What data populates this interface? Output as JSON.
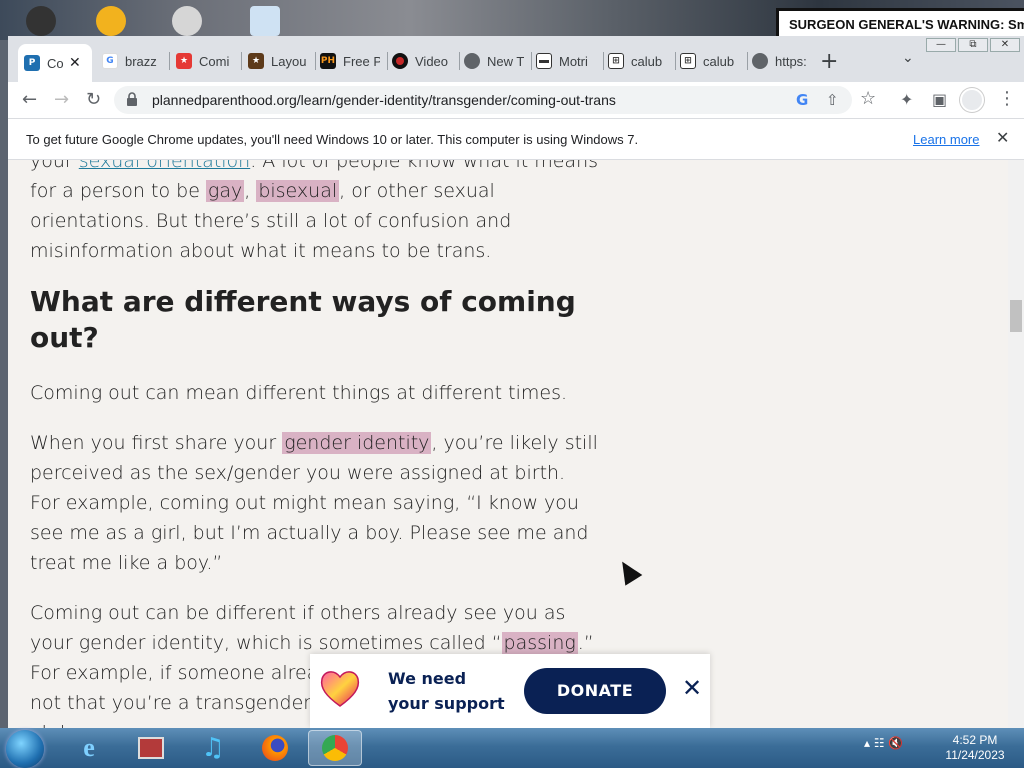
{
  "desktop": {
    "billboard_text": "SURGEON GENERAL'S WARNING: Smoking"
  },
  "window": {
    "controls": [
      "—",
      "⧉",
      "✕"
    ]
  },
  "tabs": [
    {
      "label": "Co",
      "icon": "plannedparenthood-icon",
      "color": "#1f6fb0",
      "active": true
    },
    {
      "label": "brazz",
      "icon": "google-icon",
      "color": "#4285f4"
    },
    {
      "label": "Comi",
      "icon": "red-star-icon",
      "color": "#e53935"
    },
    {
      "label": "Layou",
      "icon": "star-icon",
      "color": "#5d3a1a"
    },
    {
      "label": "Free P",
      "icon": "ph-icon",
      "color": "#f7971d"
    },
    {
      "label": "Video",
      "icon": "video-icon",
      "color": "#c62828"
    },
    {
      "label": "New T",
      "icon": "chrome-icon",
      "color": "#5f6368"
    },
    {
      "label": "Motri",
      "icon": "page-icon",
      "color": "#333333"
    },
    {
      "label": "calub",
      "icon": "building-icon",
      "color": "#333333"
    },
    {
      "label": "calub",
      "icon": "building-icon",
      "color": "#333333"
    },
    {
      "label": "https:",
      "icon": "globe-icon",
      "color": "#5f6368"
    }
  ],
  "tab_close": "✕",
  "new_tab": "+",
  "tab_list": "⌄",
  "toolbar": {
    "back": "←",
    "forward": "→",
    "reload": "↻",
    "url": "plannedparenthood.org/learn/gender-identity/transgender/coming-out-trans",
    "google_icon": "G",
    "share_icon": "⇧",
    "bookmark_icon": "☆",
    "extensions_icon": "✦",
    "sidepanel_icon": "▣",
    "menu_icon": "⋮"
  },
  "infobar": {
    "text": "To get future Google Chrome updates, you'll need Windows 10 or later. This computer is using Windows 7.",
    "link": "Learn more",
    "close": "✕"
  },
  "article": {
    "line1_pre": "your ",
    "line1_link": "sexual orientation",
    "line1_post": ". A lot of people know what it means",
    "line2_pre": "for a person to be ",
    "line2_hl1": "gay",
    "line2_mid": ", ",
    "line2_hl2": "bisexual",
    "line2_post": ", or other sexual",
    "line3": "orientations. But there’s still a lot of confusion and",
    "line4": "misinformation about what it means to be trans.",
    "heading_line1": "What are different ways of coming",
    "heading_line2": "out?",
    "para1": "Coming out can mean different things at different times.",
    "p2_l1_pre": "When you first share your ",
    "p2_l1_hl": "gender identity",
    "p2_l1_post": ", you’re likely still",
    "p2_l2": "perceived as the sex/gender you were assigned at birth.",
    "p2_l3": "For example, coming out might mean saying, “I know you",
    "p2_l4": "see me as a girl, but I’m actually a boy. Please see me and",
    "p2_l5": "treat me like a boy.”",
    "p3_l1": "Coming out can be different if others already see you as",
    "p3_l2_pre": "your gender identity, which is sometimes called “",
    "p3_l2_hl": "passing",
    "p3_l2_post": ".”",
    "p3_l3": "For example, if someone alread",
    "p3_l4": "not that you’re a transgender g",
    "p3_l5": "al    d"
  },
  "donate": {
    "line1": "We need",
    "line2": "your support",
    "button": "DONATE",
    "close": "✕"
  },
  "taskbar": {
    "items": [
      "ie-icon",
      "media-center-icon",
      "itunes-icon",
      "firefox-icon",
      "chrome-icon"
    ],
    "time": "4:52 PM",
    "date": "11/24/2023",
    "tray_icons": "▴  ☷  🔇"
  }
}
